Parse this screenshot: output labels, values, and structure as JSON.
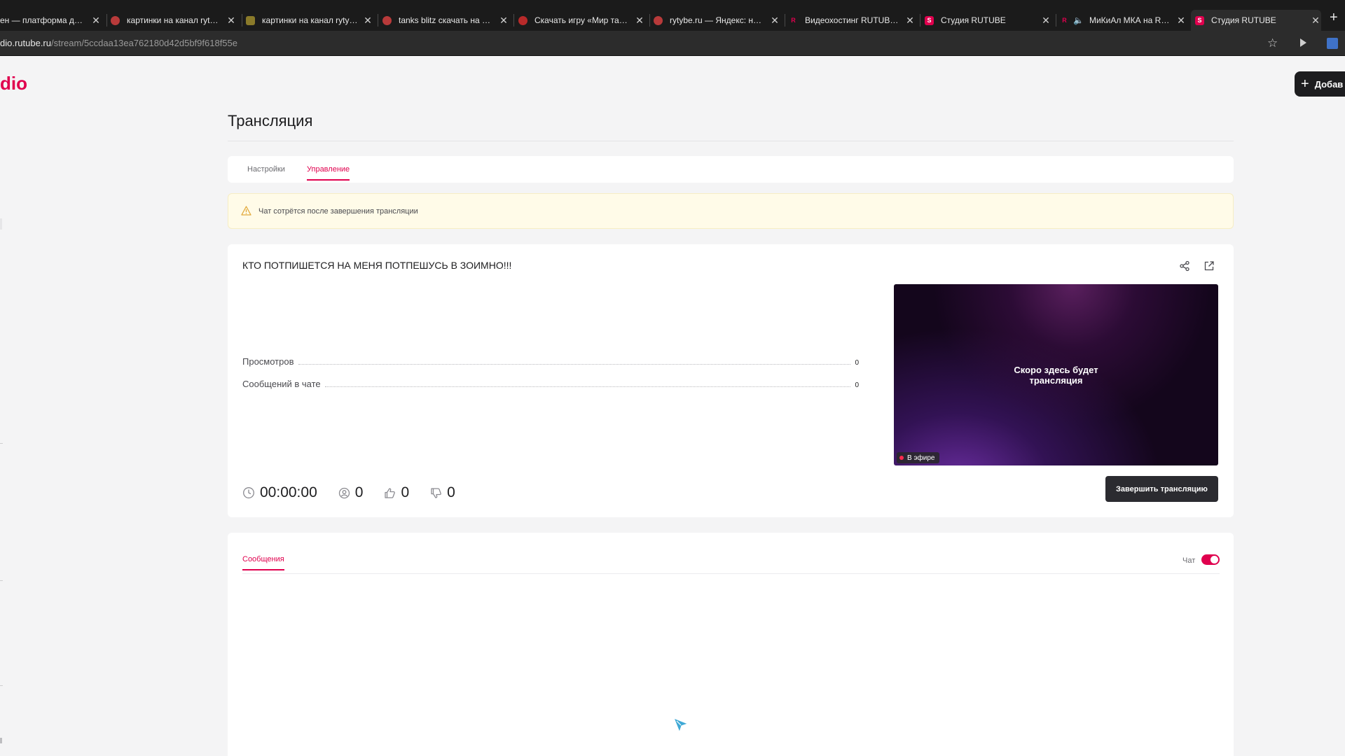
{
  "browser": {
    "tabs": [
      {
        "title": "ен — платформа для про",
        "favicon_color": "#1b1b1b",
        "active": false
      },
      {
        "title": "картинки на канал rytype —",
        "favicon_color": "#b83a3a",
        "active": false
      },
      {
        "title": "картинки на канал rytype: 1",
        "favicon_color": "#8a7a2a",
        "active": false
      },
      {
        "title": "tanks blitz скачать на пк — Я",
        "favicon_color": "#b83a3a",
        "active": false
      },
      {
        "title": "Скачать игру «Мир танков»",
        "favicon_color": "#b82a2a",
        "active": false
      },
      {
        "title": "rytybe.ru — Яндекс: нашлос",
        "favicon_color": "#b83a3a",
        "active": false
      },
      {
        "title": "Видеохостинг RUTUBE. Смот",
        "favicon_color": "#e0004e",
        "active": false
      },
      {
        "title": "Студия RUTUBE",
        "favicon_color": "#e0004e",
        "active": false
      },
      {
        "title": "МиКиАл МКА на RUTUB",
        "favicon_color": "#e0004e",
        "active": false
      },
      {
        "title": "Студия RUTUBE",
        "favicon_color": "#e0004e",
        "active": true
      }
    ],
    "url_host": "dio.rutube.ru",
    "url_path": "/stream/5ccdaa13ea762180d42d5bf9f618f55e"
  },
  "header": {
    "logo_text": "dio",
    "add_button_label": "Добав"
  },
  "page": {
    "title": "Трансляция",
    "tabs": [
      {
        "label": "Настройки",
        "active": false
      },
      {
        "label": "Управление",
        "active": true
      }
    ],
    "alert_text": "Чат сотрётся после завершения трансляции"
  },
  "stream": {
    "title": "КТО ПОТПИШЕТСЯ НА МЕНЯ ПОТПЕШУСЬ В ЗОИМНО!!!",
    "stats": [
      {
        "label": "Просмотров",
        "value": "0"
      },
      {
        "label": "Сообщений в чате",
        "value": "0"
      }
    ],
    "preview_text_line1": "Скоро здесь будет",
    "preview_text_line2": "трансляция",
    "live_badge": "В эфире",
    "duration": "00:00:00",
    "viewers": "0",
    "likes": "0",
    "dislikes": "0",
    "end_button_label": "Завершить трансляцию"
  },
  "chat": {
    "tab_label": "Сообщения",
    "toggle_label": "Чат",
    "toggle_on": true
  },
  "colors": {
    "accent": "#e0004e",
    "dark_button": "#2b2b30"
  }
}
